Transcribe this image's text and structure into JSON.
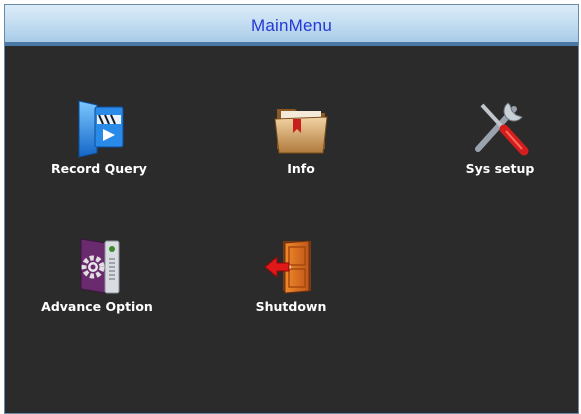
{
  "window": {
    "title": "MainMenu"
  },
  "menu": {
    "items": [
      {
        "label": "Record Query",
        "icon": "record-query-icon"
      },
      {
        "label": "Info",
        "icon": "folder-book-icon"
      },
      {
        "label": "Sys setup",
        "icon": "wrench-screwdriver-icon"
      },
      {
        "label": "Advance Option",
        "icon": "gear-server-icon"
      },
      {
        "label": "Shutdown",
        "icon": "exit-door-icon"
      }
    ]
  },
  "colors": {
    "background": "#2b2b2b",
    "title_text": "#2438d8",
    "label_text": "#ffffff",
    "title_bar": "#c6dff2"
  }
}
